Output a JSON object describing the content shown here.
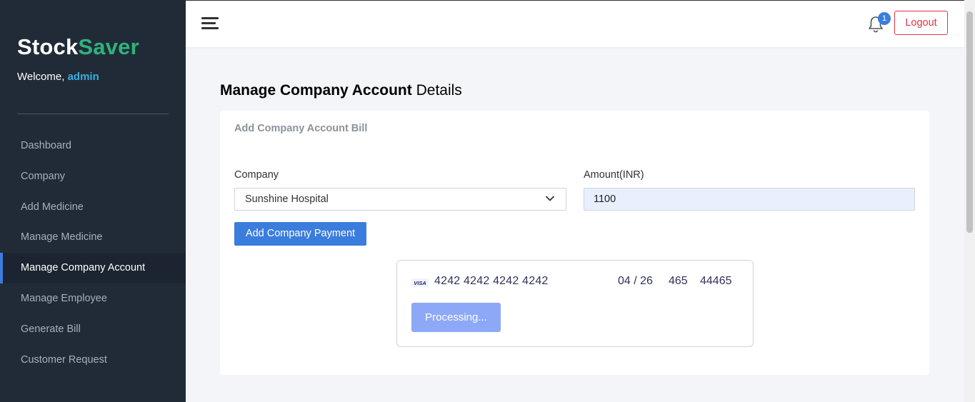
{
  "sidebar": {
    "brand_part1": "Stock",
    "brand_part2": "Saver",
    "welcome_prefix": "Welcome, ",
    "welcome_user": "admin",
    "items": [
      {
        "label": "Dashboard"
      },
      {
        "label": "Company"
      },
      {
        "label": "Add Medicine"
      },
      {
        "label": "Manage Medicine"
      },
      {
        "label": "Manage Company Account",
        "active": true
      },
      {
        "label": "Manage Employee"
      },
      {
        "label": "Generate Bill"
      },
      {
        "label": "Customer Request"
      }
    ]
  },
  "header": {
    "notification_count": "1",
    "logout_label": "Logout",
    "icons": [
      "hamburger-icon",
      "bell-icon"
    ]
  },
  "main": {
    "title_bold": "Manage Company Account",
    "title_rest": " Details",
    "card_title": "Add Company Account Bill",
    "company_label": "Company",
    "company_value": "Sunshine Hospital",
    "amount_label": "Amount(INR)",
    "amount_value": "1100",
    "add_payment_label": "Add Company Payment"
  },
  "payment": {
    "card_brand_icon": "visa-icon",
    "card_number": "4242 4242 4242 4242",
    "expiry": "04 / 26",
    "cvc": "465",
    "zip": "44465",
    "processing_label": "Processing..."
  },
  "colors": {
    "sidebar_bg": "#212b38",
    "brand_accent": "#2fb37c",
    "primary": "#3b7ddd",
    "danger": "#dc3545",
    "processing": "#8ea8f8"
  }
}
